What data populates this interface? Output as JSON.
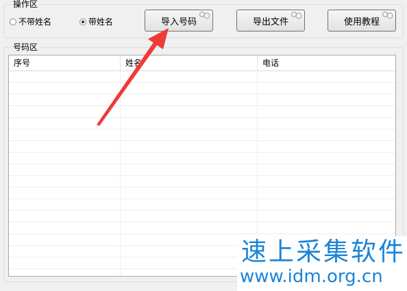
{
  "operation_group": {
    "title": "操作区",
    "radio_no_name": "不带姓名",
    "radio_with_name": "带姓名",
    "selected": "带姓名"
  },
  "buttons": {
    "import_numbers": "导入号码",
    "export_file": "导出文件",
    "tutorial": "使用教程"
  },
  "number_group": {
    "title": "号码区",
    "columns": [
      "序号",
      "姓名",
      "电话"
    ]
  },
  "watermark": {
    "title": "速上采集软件",
    "url": "www.idm.org.cn"
  },
  "colors": {
    "arrow": "#f03a3a",
    "watermark": "#1a84d8"
  }
}
